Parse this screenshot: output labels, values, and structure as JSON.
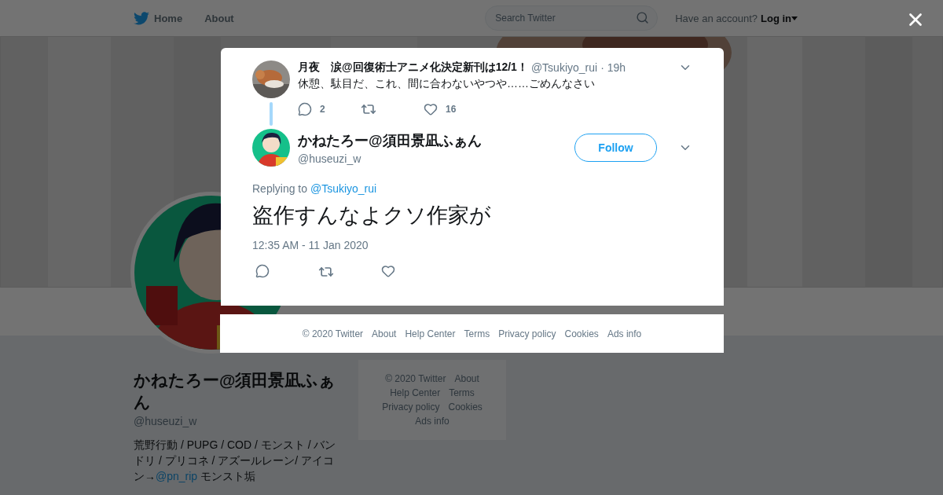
{
  "header": {
    "nav": [
      {
        "label": "Home",
        "kind": "home"
      },
      {
        "label": "About",
        "kind": "plain"
      }
    ],
    "search": {
      "placeholder": "Search Twitter"
    },
    "account_prompt": "Have an account?",
    "login": "Log in"
  },
  "profile": {
    "name": "かねたろー@須田景凪ふぁん",
    "handle": "@huseuzi_w",
    "bio": [
      {
        "kind": "text",
        "text": "荒野行動 / PUPG / COD / モンスト / バンドリ / プリコネ / アズールレーン/ アイコン→"
      },
      {
        "kind": "link",
        "text": "@pn_rip"
      },
      {
        "kind": "text",
        "text": " モンスト垢"
      }
    ]
  },
  "side_footer": [
    "© 2020 Twitter",
    "About",
    "Help Center",
    "Terms",
    "Privacy policy",
    "Cookies",
    "Ads info"
  ],
  "modal": {
    "parent_tweet": {
      "name": "月夜　涙@回復術士アニメ化決定新刊は12/1！",
      "handle": "@Tsukiyo_rui",
      "time": "· 19h",
      "text": "休憩、駄目だ、これ、間に合わないやつや……ごめんなさい",
      "replies": "2",
      "likes": "16"
    },
    "tweet": {
      "name": "かねたろー@須田景凪ふぁん",
      "handle": "@huseuzi_w",
      "follow": "Follow",
      "replying_label": "Replying to",
      "reply_to": "@Tsukiyo_rui",
      "text": "盗作すんなよクソ作家が",
      "timestamp": "12:35 AM - 11 Jan 2020"
    },
    "footer": [
      "© 2020 Twitter",
      "About",
      "Help Center",
      "Terms",
      "Privacy policy",
      "Cookies",
      "Ads info"
    ]
  }
}
